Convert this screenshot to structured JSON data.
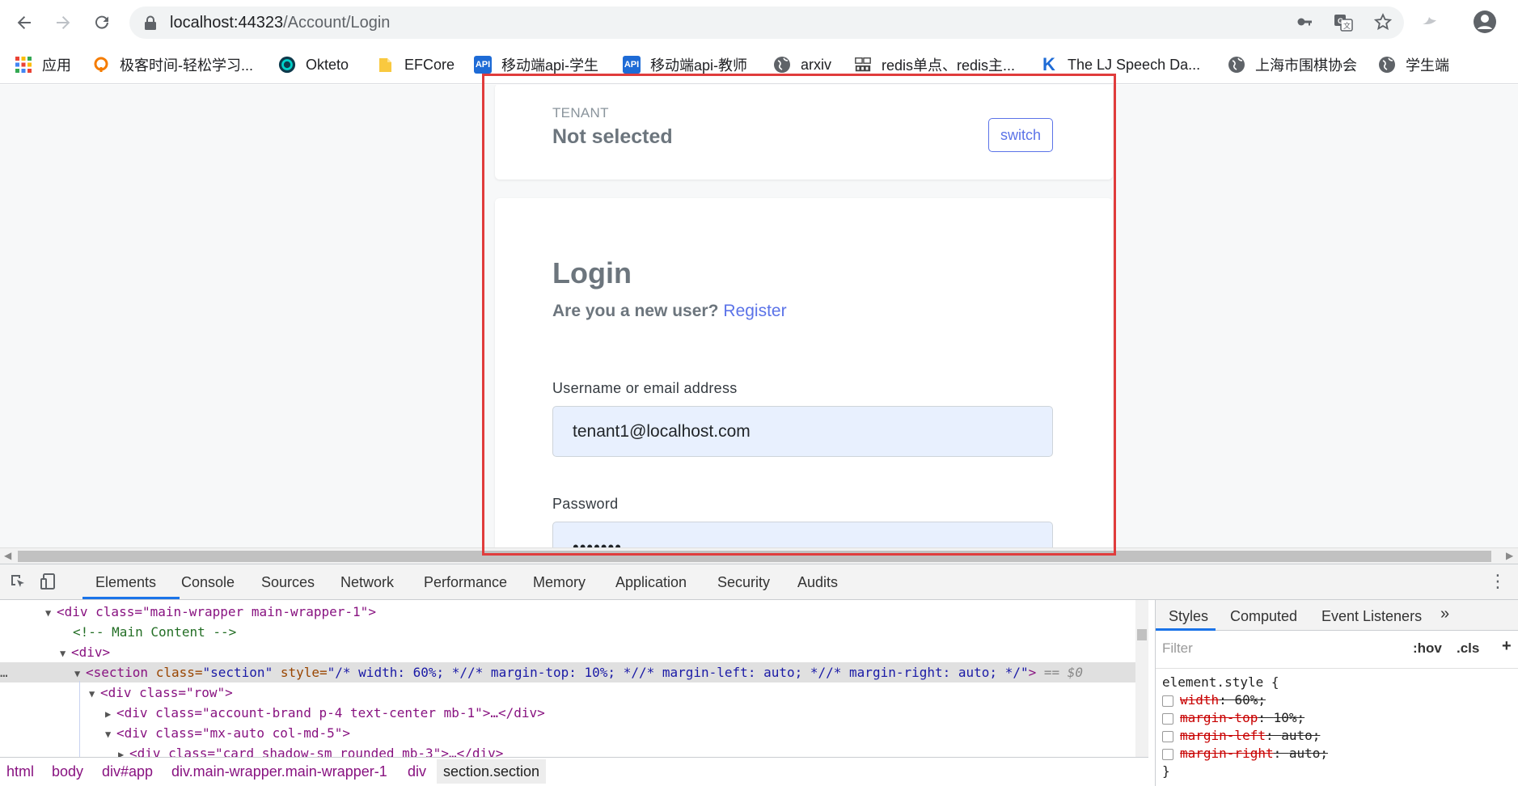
{
  "browser": {
    "url_host": "localhost:44323",
    "url_path": "/Account/Login",
    "bookmarks": [
      {
        "label": "应用",
        "color": "#e8453c"
      },
      {
        "label": "极客时间-轻松学习...",
        "color": "#f57c00"
      },
      {
        "label": "Okteto",
        "color": "#0e6e8c"
      },
      {
        "label": "EFCore",
        "color": "#f9c93f"
      },
      {
        "label": "移动端api-学生",
        "color": "#1e6bd6"
      },
      {
        "label": "移动端api-教师",
        "color": "#1e6bd6"
      },
      {
        "label": "arxiv",
        "color": "#5f6368"
      },
      {
        "label": "redis单点、redis主...",
        "color": "#5f6368"
      },
      {
        "label": "The LJ Speech Da...",
        "color": "#1e6bd6"
      },
      {
        "label": "上海市围棋协会",
        "color": "#5f6368"
      },
      {
        "label": "学生端",
        "color": "#5f6368"
      }
    ],
    "bookmark_api_badge": "API",
    "bookmark_k_badge": "K"
  },
  "page": {
    "tenant_label": "TENANT",
    "tenant_value": "Not selected",
    "switch_label": "switch",
    "login_title": "Login",
    "new_user_text": "Are you a new user?",
    "register_link": "Register",
    "username_label": "Username or email address",
    "username_value": "tenant1@localhost.com",
    "password_label": "Password",
    "password_value": "•••••••"
  },
  "devtools": {
    "tabs": [
      "Elements",
      "Console",
      "Sources",
      "Network",
      "Performance",
      "Memory",
      "Application",
      "Security",
      "Audits"
    ],
    "active_tab": "Elements",
    "elements_lines": [
      {
        "indent": 56,
        "tri": "▼",
        "html": "div_main"
      },
      {
        "indent": 88,
        "tri": "",
        "html": "comment"
      },
      {
        "indent": 72,
        "tri": "▼",
        "html": "div"
      },
      {
        "indent": 92,
        "tri": "▼",
        "html": "section"
      },
      {
        "indent": 108,
        "tri": "▼",
        "html": "row"
      },
      {
        "indent": 128,
        "tri": "▶",
        "html": "brand"
      },
      {
        "indent": 128,
        "tri": "▼",
        "html": "col"
      },
      {
        "indent": 144,
        "tri": "▶",
        "html": "card"
      }
    ],
    "el_main": "<div class=\"main-wrapper main-wrapper-1\">",
    "el_comment": "<!-- Main Content -->",
    "el_div": "<div>",
    "el_section_tag": "<section ",
    "el_section_attr1": "class=",
    "el_section_val1": "\"section\"",
    "el_section_attr2": " style=",
    "el_section_val2": "\"/* width: 60%; *//* margin-top: 10%; *//* margin-left: auto; *//* margin-right: auto; */\"",
    "el_section_close": ">",
    "el_section_eq": " == $0",
    "el_row": "<div class=\"row\">",
    "el_brand": "<div class=\"account-brand p-4 text-center mb-1\">…</div>",
    "el_col": "<div class=\"mx-auto col-md-5\">",
    "el_card": "<div class=\"card shadow-sm rounded mb-3\">…</div>",
    "ellipsis": "…",
    "breadcrumbs": [
      "html",
      "body",
      "div#app",
      "div.main-wrapper.main-wrapper-1",
      "div",
      "section.section"
    ],
    "styles_tabs": [
      "Styles",
      "Computed",
      "Event Listeners"
    ],
    "styles_more": "»",
    "filter_placeholder": "Filter",
    "hov_label": ":hov",
    "cls_label": ".cls",
    "plus_label": "+",
    "element_style_open": "element.style {",
    "style_props": [
      {
        "prop": "width",
        "value": "60%;"
      },
      {
        "prop": "margin-top",
        "value": "10%;"
      },
      {
        "prop": "margin-left",
        "value": "auto;"
      },
      {
        "prop": "margin-right",
        "value": "auto;"
      }
    ],
    "element_style_close": "}"
  }
}
